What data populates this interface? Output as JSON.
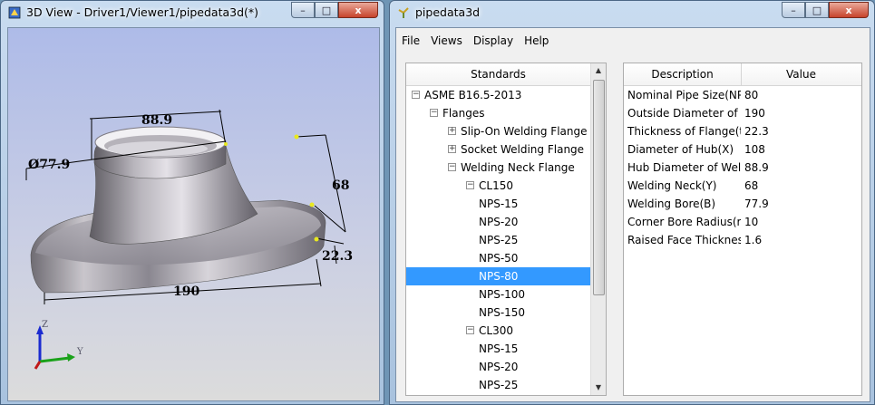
{
  "left_window": {
    "title": "3D View - Driver1/Viewer1/pipedata3d(*)",
    "controls": {
      "minimize": "–",
      "maximize": "□",
      "close": "x"
    },
    "dimensions": {
      "hub_diameter": "88.9",
      "bore": "Ø77.9",
      "neck": "68",
      "flange_thickness": "22.3",
      "outside_diameter": "190"
    },
    "axes": {
      "z": "Z",
      "y": "Y"
    }
  },
  "right_window": {
    "title": "pipedata3d",
    "controls": {
      "minimize": "–",
      "maximize": "□",
      "close": "x"
    },
    "menu": [
      "File",
      "Views",
      "Display",
      "Help"
    ],
    "tree": {
      "header": "Standards",
      "rows": [
        {
          "label": "ASME B16.5-2013",
          "indent": 0,
          "expander": "−"
        },
        {
          "label": "Flanges",
          "indent": 1,
          "expander": "−"
        },
        {
          "label": "Slip-On Welding Flange",
          "indent": 2,
          "expander": "+"
        },
        {
          "label": "Socket Welding Flange",
          "indent": 2,
          "expander": "+"
        },
        {
          "label": "Welding Neck Flange",
          "indent": 2,
          "expander": "−"
        },
        {
          "label": "CL150",
          "indent": 3,
          "expander": "−"
        },
        {
          "label": "NPS-15",
          "indent": 4,
          "expander": ""
        },
        {
          "label": "NPS-20",
          "indent": 4,
          "expander": ""
        },
        {
          "label": "NPS-25",
          "indent": 4,
          "expander": ""
        },
        {
          "label": "NPS-50",
          "indent": 4,
          "expander": ""
        },
        {
          "label": "NPS-80",
          "indent": 4,
          "expander": "",
          "selected": true
        },
        {
          "label": "NPS-100",
          "indent": 4,
          "expander": ""
        },
        {
          "label": "NPS-150",
          "indent": 4,
          "expander": ""
        },
        {
          "label": "CL300",
          "indent": 3,
          "expander": "−"
        },
        {
          "label": "NPS-15",
          "indent": 4,
          "expander": ""
        },
        {
          "label": "NPS-20",
          "indent": 4,
          "expander": ""
        },
        {
          "label": "NPS-25",
          "indent": 4,
          "expander": ""
        }
      ]
    },
    "properties": {
      "headers": {
        "description": "Description",
        "value": "Value"
      },
      "rows": [
        {
          "description": "Nominal Pipe Size(NPS",
          "value": "80"
        },
        {
          "description": "Outside Diameter of Fla",
          "value": "190"
        },
        {
          "description": "Thickness of Flange(tf)",
          "value": "22.3"
        },
        {
          "description": "Diameter of Hub(X)",
          "value": "108"
        },
        {
          "description": "Hub Diameter of Weldi",
          "value": "88.9"
        },
        {
          "description": "Welding Neck(Y)",
          "value": "68"
        },
        {
          "description": "Welding Bore(B)",
          "value": "77.9"
        },
        {
          "description": "Corner Bore Radius(r)",
          "value": "10"
        },
        {
          "description": "Raised Face Thickness(",
          "value": "1.6"
        }
      ]
    }
  }
}
